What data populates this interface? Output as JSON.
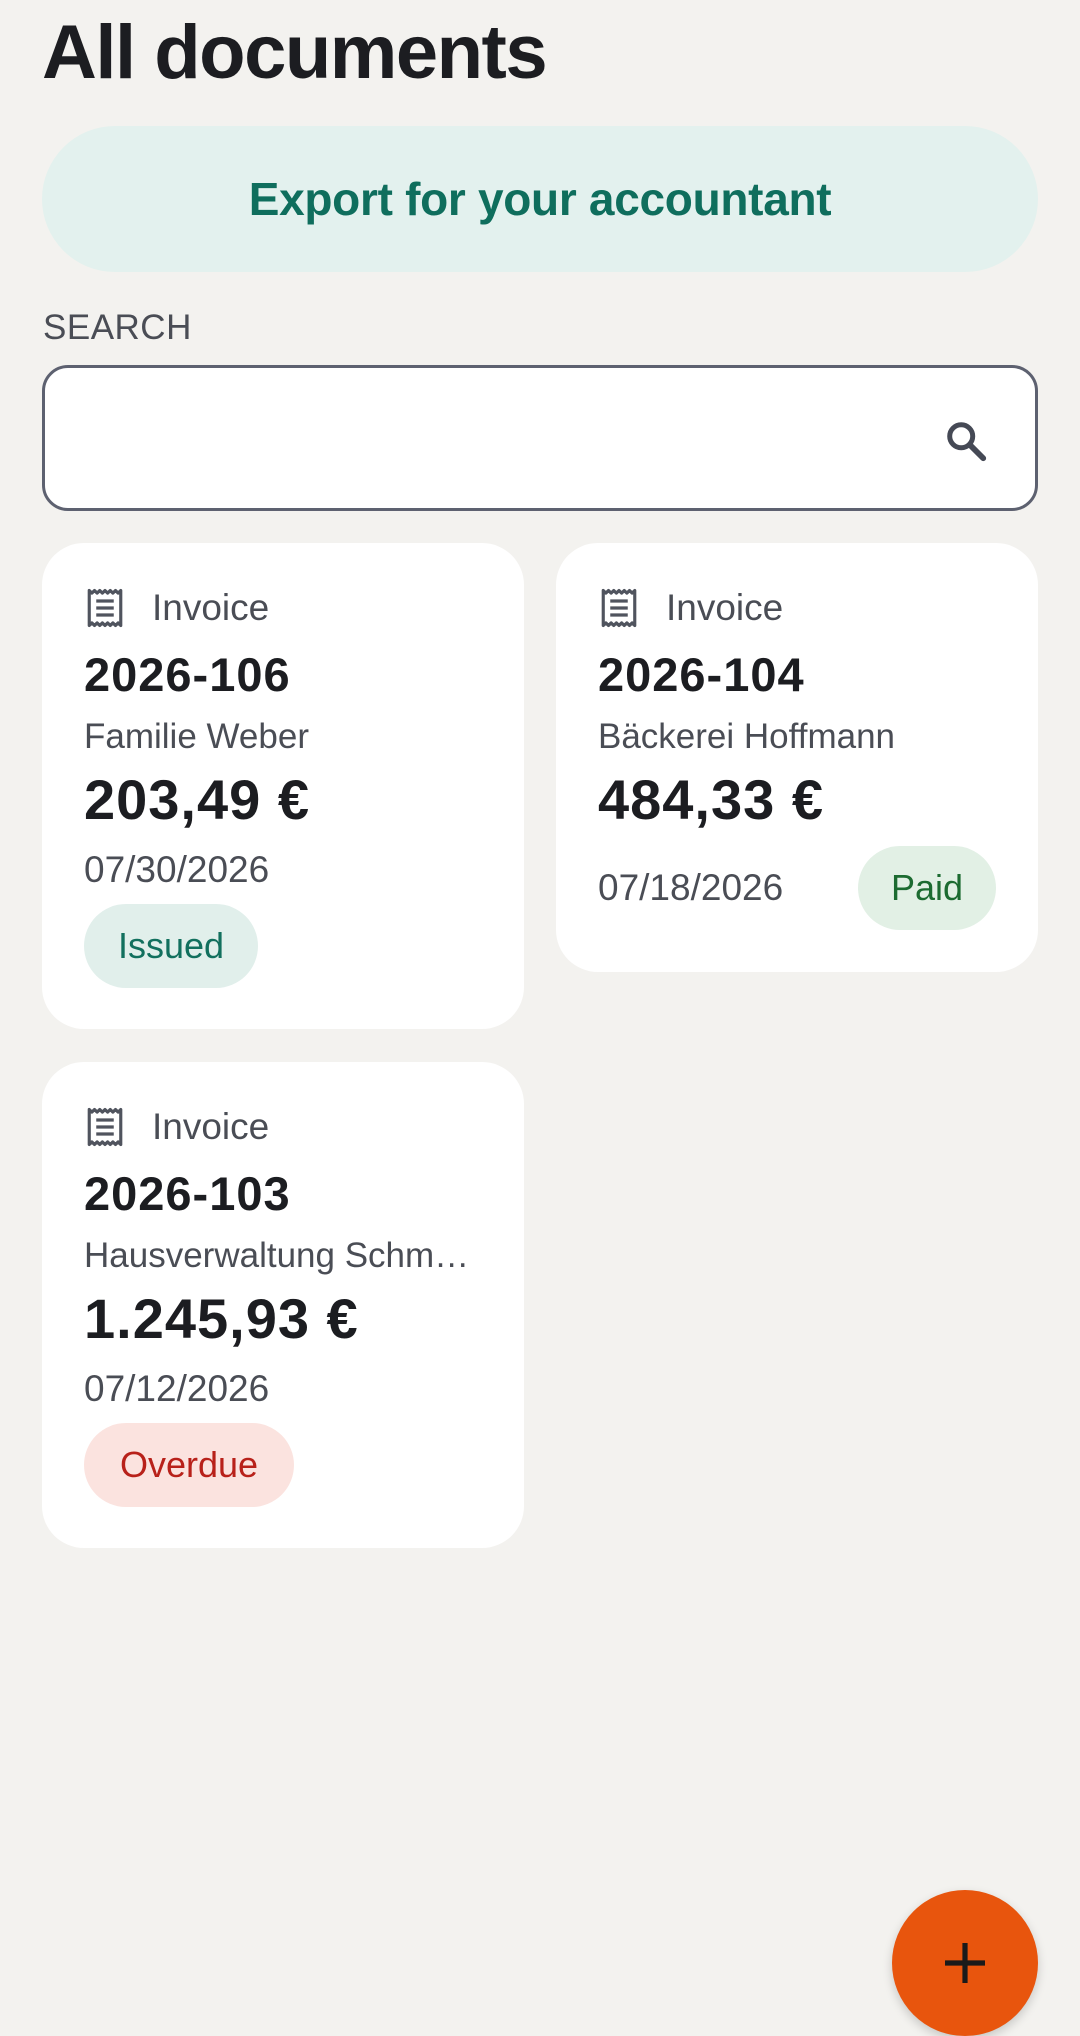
{
  "header": {
    "title": "All documents"
  },
  "actions": {
    "export_label": "Export for your accountant"
  },
  "search": {
    "label": "SEARCH",
    "value": "",
    "placeholder": "",
    "icon": "search-icon"
  },
  "documents": [
    {
      "type": "Invoice",
      "number": "2026-106",
      "client": "Familie Weber",
      "amount": "203,49 €",
      "date": "07/30/2026",
      "status": "Issued"
    },
    {
      "type": "Invoice",
      "number": "2026-104",
      "client": "Bäckerei Hoffmann",
      "amount": "484,33 €",
      "date": "07/18/2026",
      "status": "Paid"
    },
    {
      "type": "Invoice",
      "number": "2026-103",
      "client": "Hausverwaltung Schm…",
      "amount": "1.245,93 €",
      "date": "07/12/2026",
      "status": "Overdue"
    }
  ],
  "fab": {
    "icon": "plus-icon"
  },
  "colors": {
    "background": "#f3f2ef",
    "accent": "#0f6e5d",
    "fab": "#e8550d",
    "status_issued": "#12705e",
    "status_paid": "#1c6b31",
    "status_overdue": "#b8211a"
  }
}
